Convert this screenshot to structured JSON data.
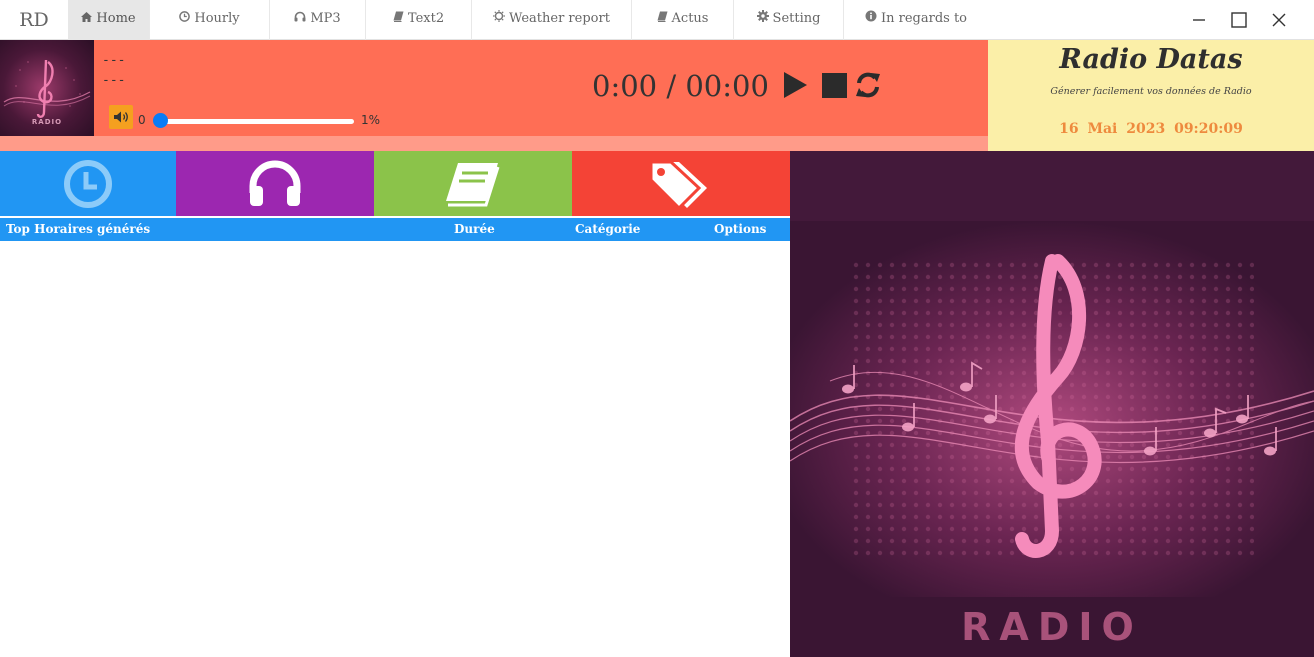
{
  "app": {
    "brand": "RD"
  },
  "nav": {
    "items": [
      {
        "label": "Home",
        "icon": "home-icon",
        "active": true
      },
      {
        "label": "Hourly",
        "icon": "clock-icon"
      },
      {
        "label": "MP3",
        "icon": "headphones-icon"
      },
      {
        "label": "Text2",
        "icon": "book-icon"
      },
      {
        "label": "Weather report",
        "icon": "sun-icon"
      },
      {
        "label": "Actus",
        "icon": "book-icon"
      },
      {
        "label": "Setting",
        "icon": "gear-icon"
      },
      {
        "label": "In regards to",
        "icon": "info-icon"
      }
    ]
  },
  "window_controls": [
    "minimize-icon",
    "maximize-icon",
    "close-icon"
  ],
  "player": {
    "line1": "---",
    "line2": "---",
    "volume_min": "0",
    "volume_pct": "1%",
    "volume_fraction": 0.01,
    "time": "0:00 / 00:00",
    "controls": [
      "play-icon",
      "stop-icon",
      "refresh-icon"
    ]
  },
  "info": {
    "title": "Radio Datas",
    "subtitle": "Génerer facilement vos données de Radio",
    "date": "16 Mai 2023",
    "time": "09:20:09"
  },
  "tiles": [
    {
      "icon": "clock-icon",
      "color": "#2196f3"
    },
    {
      "icon": "headphones-icon",
      "color": "#9c27b0"
    },
    {
      "icon": "book-icon",
      "color": "#8bc34a"
    },
    {
      "icon": "tags-icon",
      "color": "#f44336"
    }
  ],
  "table": {
    "columns": [
      "Top Horaires générés",
      "Durée",
      "Catégorie",
      "Options"
    ],
    "rows": []
  },
  "artwork": {
    "word": "RADIO"
  }
}
